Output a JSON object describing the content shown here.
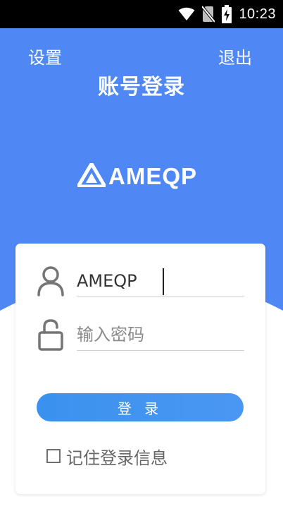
{
  "status_bar": {
    "time": "10:23",
    "icons": [
      "wifi-icon",
      "no-sim-icon",
      "battery-charging-icon"
    ]
  },
  "header": {
    "settings_label": "设置",
    "exit_label": "退出",
    "title": "账号登录"
  },
  "logo": {
    "text": "AMEQP",
    "icon": "logo-mark-icon"
  },
  "form": {
    "username": {
      "value": "AMEQP",
      "icon": "user-icon"
    },
    "password": {
      "placeholder": "输入密码",
      "icon": "unlock-icon"
    },
    "login_label": "登 录",
    "remember_label": "记住登录信息",
    "remember_checked": false
  },
  "colors": {
    "header_blue": "#4f88f5",
    "button_blue": "#3a92ee",
    "status_bar": "#000000",
    "icon_gray": "#757575"
  }
}
